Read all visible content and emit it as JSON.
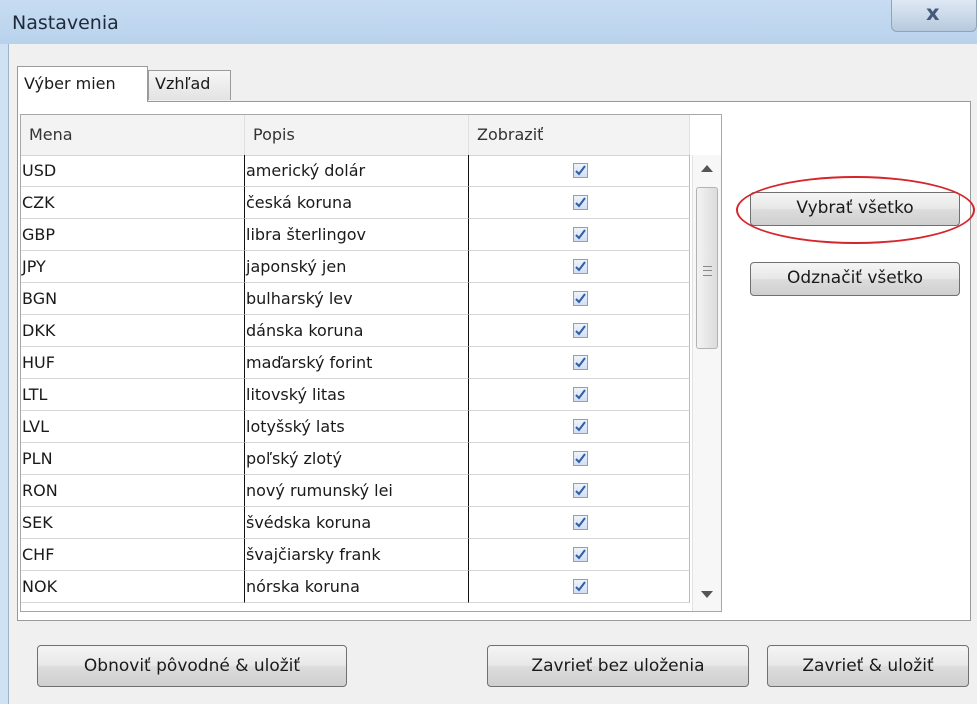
{
  "window": {
    "title": "Nastavenia",
    "close_glyph": "x"
  },
  "tabs": [
    {
      "label": "Výber mien",
      "active": true
    },
    {
      "label": "Vzhľad",
      "active": false
    }
  ],
  "grid": {
    "columns": [
      "Mena",
      "Popis",
      "Zobraziť"
    ],
    "rows": [
      {
        "code": "USD",
        "description": "americký dolár",
        "show": true
      },
      {
        "code": "CZK",
        "description": "česká koruna",
        "show": true
      },
      {
        "code": "GBP",
        "description": "libra šterlingov",
        "show": true
      },
      {
        "code": "JPY",
        "description": "japonský jen",
        "show": true
      },
      {
        "code": "BGN",
        "description": "bulharský lev",
        "show": true
      },
      {
        "code": "DKK",
        "description": "dánska koruna",
        "show": true
      },
      {
        "code": "HUF",
        "description": "maďarský forint",
        "show": true
      },
      {
        "code": "LTL",
        "description": "litovský litas",
        "show": true
      },
      {
        "code": "LVL",
        "description": "lotyšský lats",
        "show": true
      },
      {
        "code": "PLN",
        "description": "poľský zlotý",
        "show": true
      },
      {
        "code": "RON",
        "description": "nový rumunský lei",
        "show": true
      },
      {
        "code": "SEK",
        "description": "švédska koruna",
        "show": true
      },
      {
        "code": "CHF",
        "description": "švajčiarsky frank",
        "show": true
      },
      {
        "code": "NOK",
        "description": "nórska koruna",
        "show": true
      }
    ]
  },
  "side_buttons": {
    "select_all": "Vybrať všetko",
    "deselect_all": "Odznačiť všetko"
  },
  "bottom_buttons": {
    "reset": "Obnoviť pôvodné & uložiť",
    "close_no_save": "Zavrieť bez uloženia",
    "close_save": "Zavrieť & uložiť"
  },
  "colors": {
    "annotation": "#d6252b",
    "checkbox_check": "#2d5fa8"
  },
  "icons": {
    "checkbox": "checkmark-icon",
    "close": "close-icon"
  }
}
